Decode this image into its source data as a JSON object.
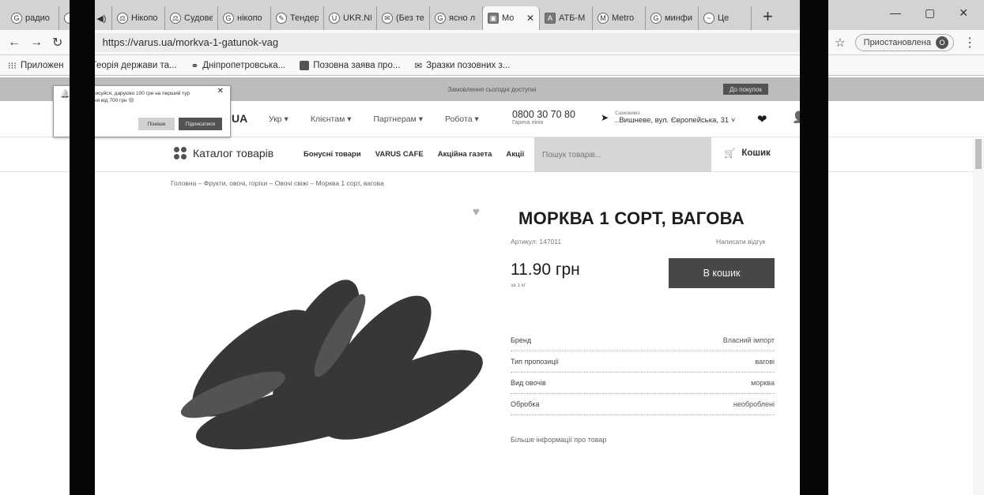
{
  "tabs": [
    {
      "title": "радио",
      "icon": "G"
    },
    {
      "title": "ите. ◀)",
      "icon": ""
    },
    {
      "title": "Нікопо",
      "icon": "⚖"
    },
    {
      "title": "Судове",
      "icon": "⚖"
    },
    {
      "title": "нікопо",
      "icon": "G"
    },
    {
      "title": "Тендер",
      "icon": "✎"
    },
    {
      "title": "UKR.NE",
      "icon": "U"
    },
    {
      "title": "(Без те",
      "icon": "✉"
    },
    {
      "title": "ясно л",
      "icon": "G"
    },
    {
      "title": "Мо",
      "icon": "▣"
    },
    {
      "title": "АТБ-М",
      "icon": "A"
    },
    {
      "title": "Metro",
      "icon": "M"
    },
    {
      "title": "минфи",
      "icon": "G"
    },
    {
      "title": "Це",
      "icon": "~"
    }
  ],
  "active_tab_close": "✕",
  "new_tab": "+",
  "window": {
    "minimize": "—",
    "restore": "▢",
    "close": "✕"
  },
  "address": {
    "url": "https://varus.ua/morkva-1-gatunok-vag",
    "paused_label": "Приостановлена",
    "avatar": "О"
  },
  "bookmarks": [
    "Приложен",
    "Теорія держави та...",
    "Дніпропетровська...",
    "Позовна заява про...",
    "Зразки позовних з..."
  ],
  "banner": {
    "text": "Замовлення сьогодні доступні",
    "button": "До покупок"
  },
  "header": {
    "logo": "UA",
    "nav": [
      "Укр ▾",
      "Клієнтам ▾",
      "Партнерам ▾",
      "Робота ▾"
    ],
    "phone": "0800 30 70 80",
    "phone_sub": "Гаряча лінія",
    "loc_label": "Самовивіз",
    "loc_value": "..Вишневе, вул. Європейська, 31 ˅"
  },
  "catbar": {
    "catalog": "Каталог товарів",
    "links": [
      "Бонусні товари",
      "VARUS CAFE",
      "Акційна газета",
      "Акції"
    ],
    "search_placeholder": "Пошук товарів...",
    "cart": "Кошик"
  },
  "breadcrumb": "Головна – Фрукти, овочі, горіхи – Овочі свіжі – Морква 1 сорт, вагова",
  "product": {
    "title": "МОРКВА 1 СОРТ, ВАГОВА",
    "sku": "Артикул: 147011",
    "review": "Написати відгук",
    "price": "11.90 грн",
    "unit": "за 1 кг",
    "buy": "В кошик",
    "specs": [
      {
        "k": "Бренд",
        "v": "Власний імпорт"
      },
      {
        "k": "Тип пропозиції",
        "v": "вагові"
      },
      {
        "k": "Вид овочів",
        "v": "морква"
      },
      {
        "k": "Обробка",
        "v": "необроблені"
      }
    ],
    "more": "Більше інформації про товар"
  },
  "popup": {
    "text": "Якщо підписуйся, даруємо 100 грн на перший тур замовлення від 700 грн 🙂",
    "later": "Пізніше",
    "subscribe": "Підписатися"
  }
}
